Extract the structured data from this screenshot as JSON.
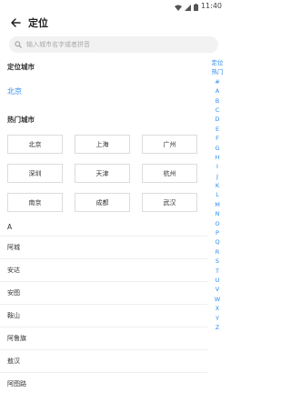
{
  "statusbar": {
    "time": "11:40"
  },
  "appbar": {
    "title": "定位"
  },
  "search": {
    "placeholder": "输入城市名字或者拼音"
  },
  "locate": {
    "title": "定位城市",
    "city": "北京"
  },
  "hot": {
    "title": "热门城市",
    "cities": [
      "北京",
      "上海",
      "广州",
      "深圳",
      "天津",
      "杭州",
      "南京",
      "成都",
      "武汉"
    ]
  },
  "list": {
    "letter": "A",
    "cities": [
      "阿城",
      "安达",
      "安图",
      "鞍山",
      "阿鲁旗",
      "敖汉",
      "阿图路"
    ]
  },
  "index": [
    "定位",
    "热门",
    "#",
    "A",
    "B",
    "C",
    "D",
    "E",
    "F",
    "G",
    "H",
    "I",
    "J",
    "K",
    "L",
    "M",
    "N",
    "O",
    "P",
    "Q",
    "R",
    "S",
    "T",
    "U",
    "V",
    "W",
    "X",
    "Y",
    "Z"
  ],
  "colors": {
    "accent": "#2d8cf0",
    "search_bg": "#f2f2f2"
  }
}
